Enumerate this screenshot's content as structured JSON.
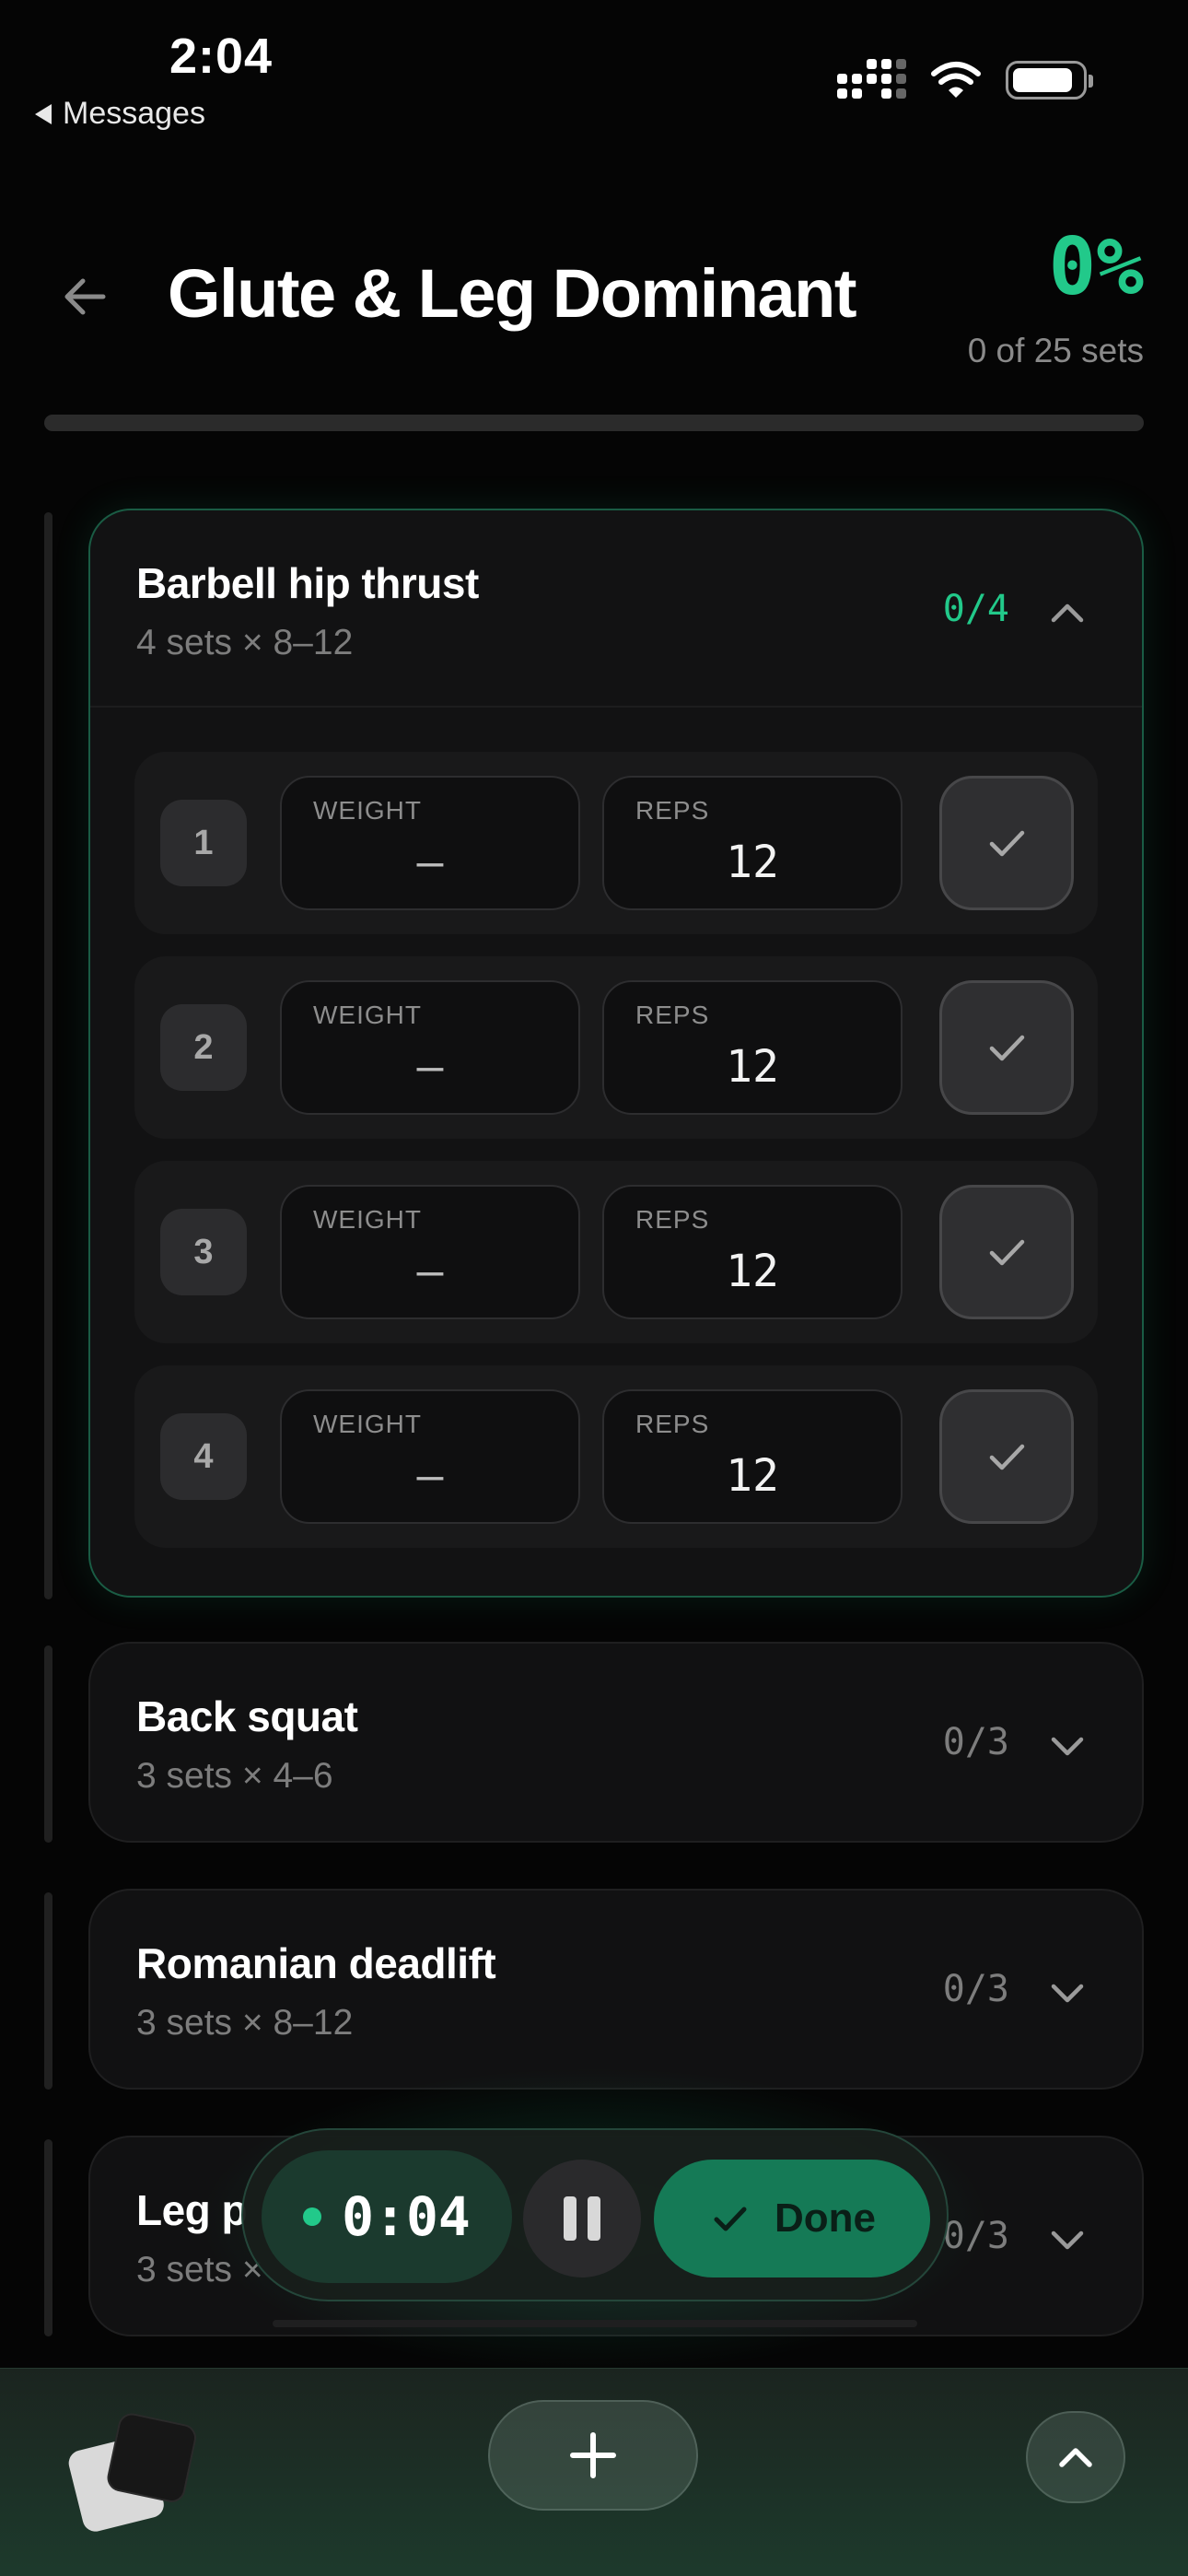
{
  "status_bar": {
    "time": "2:04",
    "back_label": "Messages"
  },
  "header": {
    "title": "Glute & Leg Dominant",
    "percent": "0%",
    "progress_text": "0 of 25 sets",
    "progress_fraction": 0
  },
  "exercises": [
    {
      "name": "Barbell hip thrust",
      "meta": "4 sets × 8–12",
      "count": "0/4",
      "expanded": true,
      "sets": [
        {
          "num": "1",
          "weight_label": "WEIGHT",
          "weight": "—",
          "reps_label": "REPS",
          "reps": "12"
        },
        {
          "num": "2",
          "weight_label": "WEIGHT",
          "weight": "—",
          "reps_label": "REPS",
          "reps": "12"
        },
        {
          "num": "3",
          "weight_label": "WEIGHT",
          "weight": "—",
          "reps_label": "REPS",
          "reps": "12"
        },
        {
          "num": "4",
          "weight_label": "WEIGHT",
          "weight": "—",
          "reps_label": "REPS",
          "reps": "12"
        }
      ]
    },
    {
      "name": "Back squat",
      "meta": "3 sets × 4–6",
      "count": "0/3",
      "expanded": false
    },
    {
      "name": "Romanian deadlift",
      "meta": "3 sets × 8–12",
      "count": "0/3",
      "expanded": false
    },
    {
      "name": "Leg p",
      "meta": "3 sets ×",
      "count": "0/3",
      "expanded": false
    }
  ],
  "timer": {
    "time": "0:04",
    "done_label": "Done"
  },
  "colors": {
    "accent": "#22c98a",
    "background": "#050505",
    "card": "#111112"
  },
  "icons": {
    "back": "arrow-left-icon",
    "collapse": "chevron-up-icon",
    "expand": "chevron-down-icon",
    "check": "check-icon",
    "pause": "pause-icon",
    "add": "plus-icon",
    "scroll_top": "chevron-up-icon"
  }
}
